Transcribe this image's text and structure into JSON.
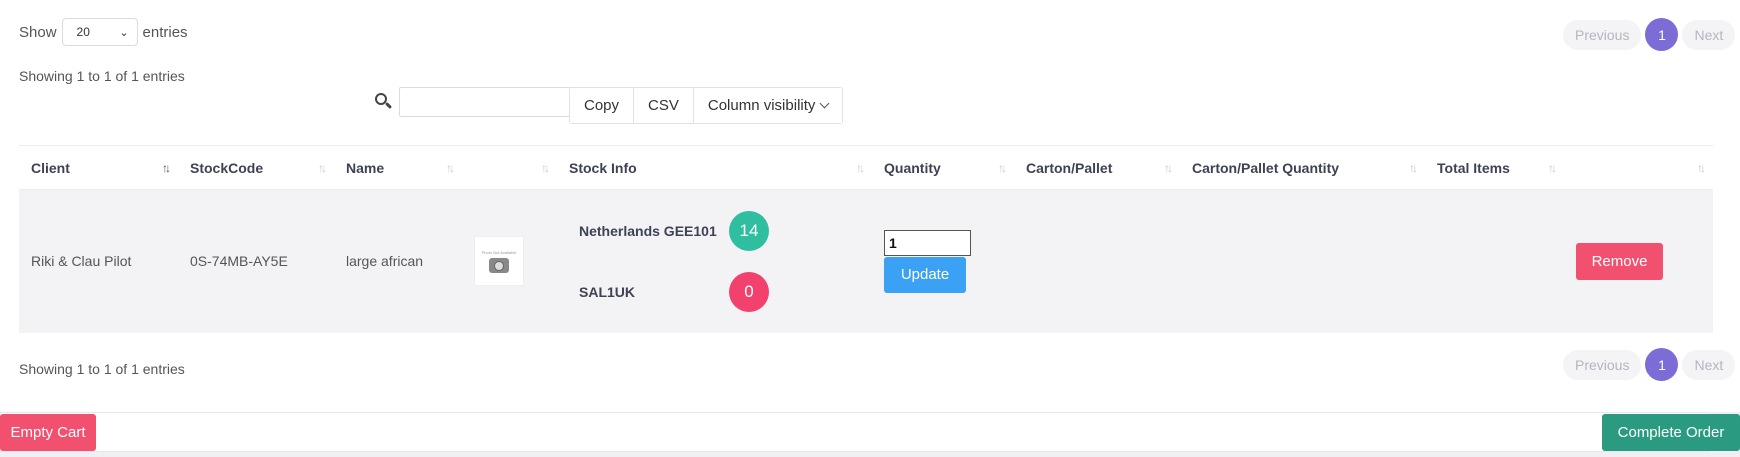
{
  "length_menu": {
    "show_label": "Show",
    "selected": "20",
    "entries_label": "entries"
  },
  "pagination": {
    "previous": "Previous",
    "current": "1",
    "next": "Next"
  },
  "info_text": "Showing 1 to 1 of 1 entries",
  "search": {
    "placeholder": "",
    "value": ""
  },
  "toolbar": {
    "copy": "Copy",
    "csv": "CSV",
    "column_visibility": "Column visibility"
  },
  "table": {
    "columns": [
      "Client",
      "StockCode",
      "Name",
      "",
      "Stock Info",
      "Quantity",
      "Carton/Pallet",
      "Carton/Pallet Quantity",
      "Total Items",
      ""
    ],
    "sort_active_column": "Client",
    "rows": [
      {
        "client": "Riki & Clau Pilot",
        "stockcode": "0S-74MB-AY5E",
        "name": "large african",
        "thumb_text": "Photo Not Available",
        "stock_info": [
          {
            "location": "Netherlands GEE101",
            "count": "14",
            "color": "#2fbfa0"
          },
          {
            "location": "SAL1UK",
            "count": "0",
            "color": "#f1416c"
          }
        ],
        "quantity": "1",
        "carton_pallet": "",
        "carton_pallet_quantity": "",
        "total_items": "",
        "update_label": "Update",
        "remove_label": "Remove"
      }
    ]
  },
  "footer": {
    "empty_cart": "Empty Cart",
    "complete_order": "Complete Order"
  },
  "colors": {
    "accent": "#7b6cd6",
    "danger": "#f1516f",
    "primary": "#3aa1f5",
    "success": "#2a9b80"
  }
}
